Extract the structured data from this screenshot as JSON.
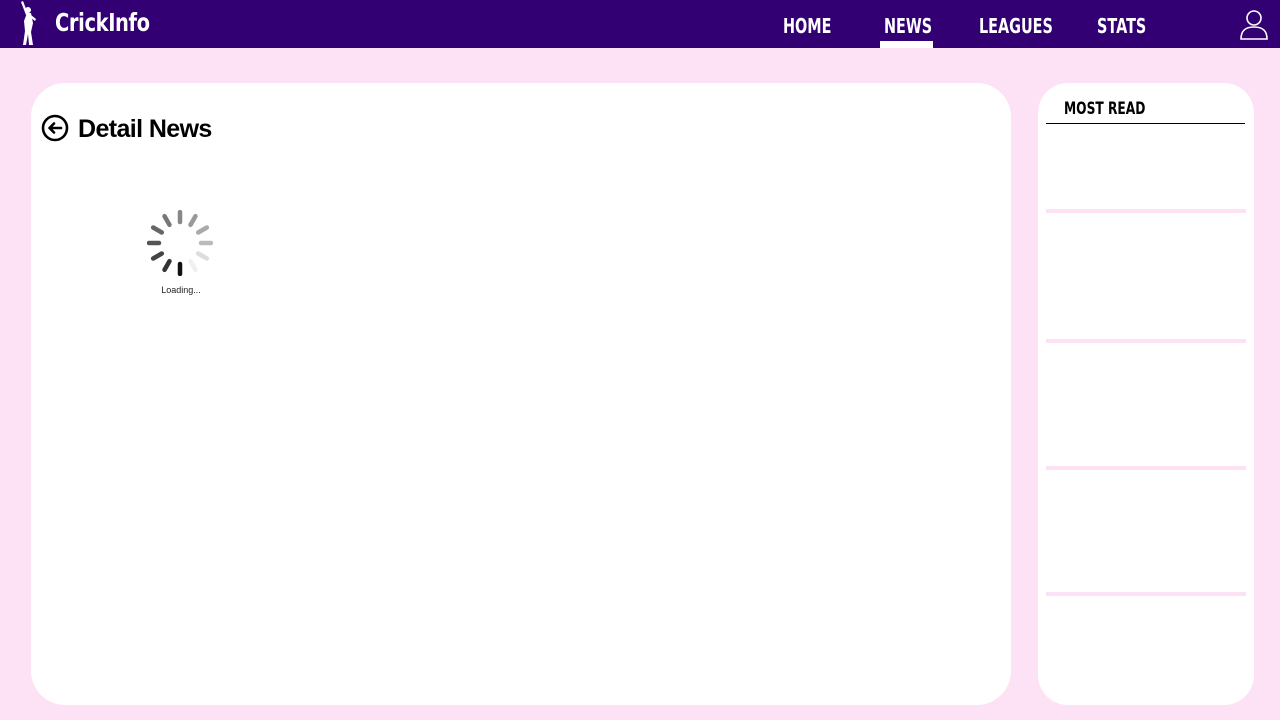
{
  "header": {
    "brand": "CrickInfo",
    "logo_icon": "cricket-batsman-icon",
    "nav": [
      {
        "label": "HOME",
        "active": false
      },
      {
        "label": "NEWS",
        "active": true
      },
      {
        "label": "LEAGUES",
        "active": false
      },
      {
        "label": "STATS",
        "active": false
      }
    ],
    "user_icon": "user-icon"
  },
  "main": {
    "back_icon": "arrow-left-circle-icon",
    "title": "Detail News",
    "loading_text": "Loading..."
  },
  "sidebar": {
    "title": "MOST READ",
    "items": [
      {},
      {},
      {},
      {},
      {}
    ]
  },
  "colors": {
    "navbar": "#330074",
    "background": "#fde1f4",
    "card": "#ffffff"
  }
}
